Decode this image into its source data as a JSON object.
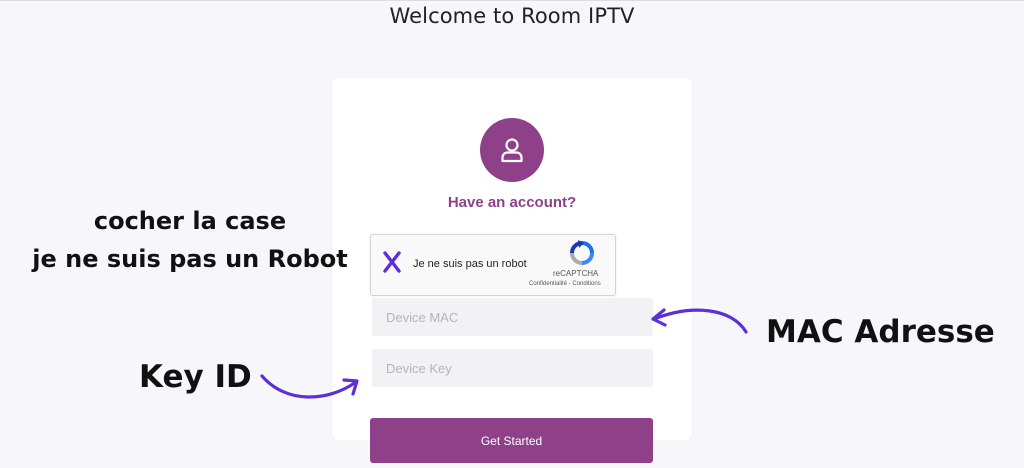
{
  "page": {
    "title": "Welcome to Room IPTV"
  },
  "login_card": {
    "subtitle": "Have an account?",
    "avatar_icon": "user-icon",
    "recaptcha": {
      "label": "Je ne suis pas un robot",
      "brand": "reCAPTCHA",
      "links": "Confidentialité - Conditions",
      "checkbox_icon": "x-mark-icon"
    },
    "device_mac": {
      "placeholder": "Device MAC",
      "value": ""
    },
    "device_key": {
      "placeholder": "Device Key",
      "value": ""
    },
    "submit_label": "Get Started"
  },
  "annotations": {
    "captcha_note": [
      "cocher la case",
      "je ne suis pas un Robot"
    ],
    "mac_note": "MAC Adresse",
    "key_note": "Key ID"
  },
  "colors": {
    "accent": "#8e4189",
    "arrow": "#5d2fd6",
    "background": "#f7f7fb",
    "field_bg": "#f2f2f4",
    "recaptcha_blue": "#1a73e8"
  }
}
